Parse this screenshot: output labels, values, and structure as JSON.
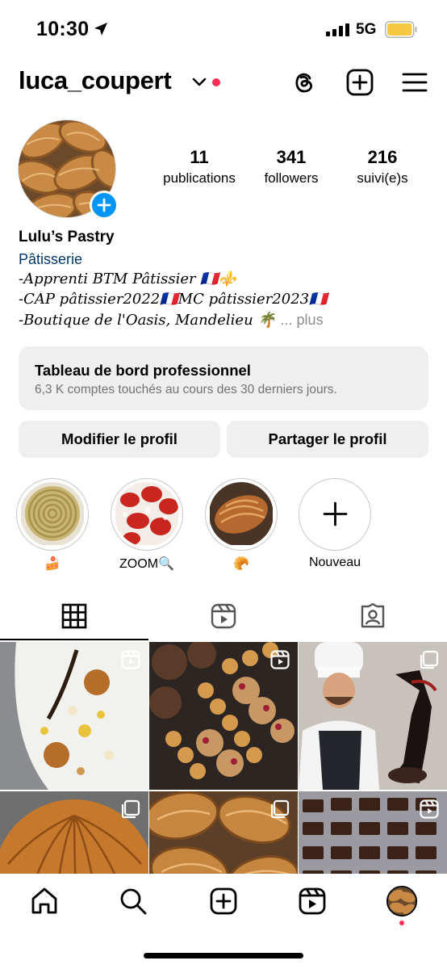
{
  "status_bar": {
    "time": "10:30",
    "network": "5G",
    "battery_color": "#f5c842"
  },
  "header": {
    "username": "luca_coupert"
  },
  "stats": [
    {
      "value": "11",
      "label": "publications"
    },
    {
      "value": "341",
      "label": "followers"
    },
    {
      "value": "216",
      "label": "suivi(e)s"
    }
  ],
  "bio": {
    "name": "Lulu’s Pastry",
    "category": "Pâtisserie",
    "lines": [
      "-Apprenti BTM Pâtissier 🇫🇷⚜️",
      "-CAP pâtissier2022🇫🇷MC pâtissier2023🇫🇷",
      "-Boutique de l'Oasis, Mandelieu 🌴"
    ],
    "more": "... plus"
  },
  "dashboard": {
    "title": "Tableau de bord professionnel",
    "subtitle": "6,3 K comptes touchés au cours des 30 derniers jours."
  },
  "buttons": {
    "edit": "Modifier le profil",
    "share": "Partager le profil"
  },
  "highlights": [
    {
      "label": "🍰"
    },
    {
      "label": "ZOOM🔍"
    },
    {
      "label": "🥐"
    },
    {
      "label": "Nouveau"
    }
  ],
  "tabs": [
    "grid-icon",
    "reels-icon",
    "tagged-icon"
  ],
  "bottom_nav": [
    "home-icon",
    "search-icon",
    "create-icon",
    "reels-icon",
    "profile-avatar"
  ],
  "colors": {
    "accent": "#0095f6",
    "link": "#00376b",
    "notification": "#ff2d55"
  }
}
